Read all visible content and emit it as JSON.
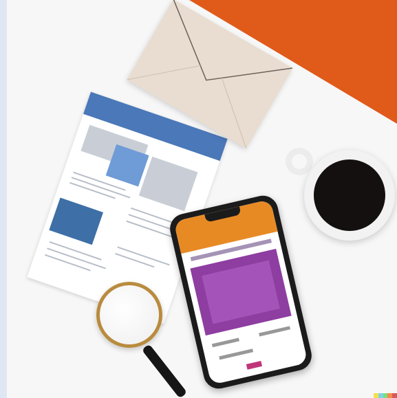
{
  "colors": {
    "background": "#f7f7f7",
    "orange_accent": "#e05a1a",
    "document_blue": "#4a78b8",
    "phone_orange": "#e88a24",
    "phone_purple": "#8e3da1",
    "coffee": "#141010",
    "envelope": "#e8ddd0",
    "magnifier_rim": "#b98b3e"
  },
  "objects": {
    "envelope_icon": "envelope-icon",
    "document_icon": "document-icon",
    "phone_icon": "smartphone-icon",
    "coffee_icon": "coffee-mug-icon",
    "magnifier_icon": "magnifying-glass-icon"
  }
}
